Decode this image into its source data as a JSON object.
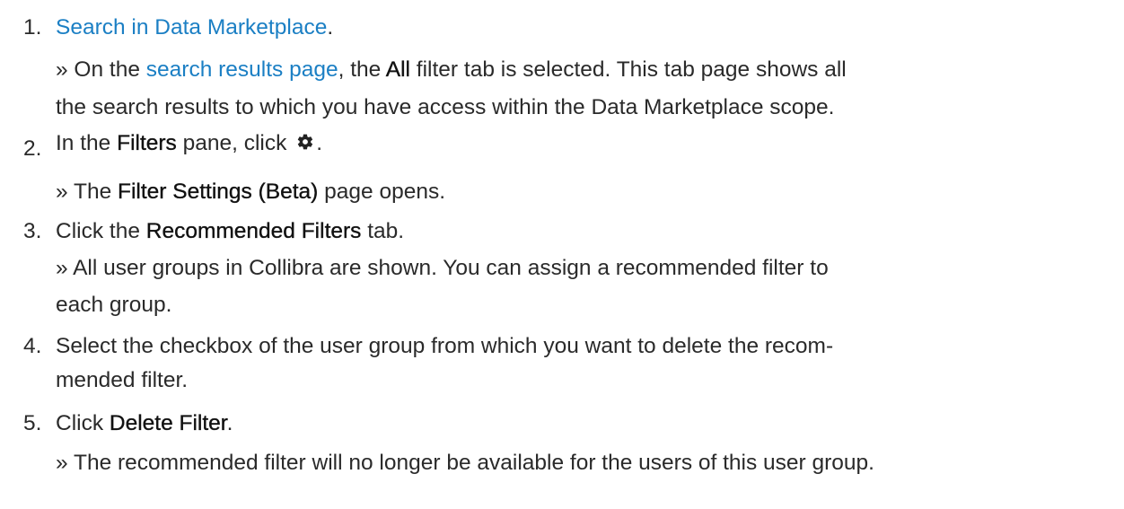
{
  "steps": [
    {
      "number": "1.",
      "link_text": "Search in Data Marketplace",
      "period": ".",
      "result": {
        "prefix": "» On the ",
        "link_text": "search results page",
        "mid1": ", the ",
        "bold": "All",
        "rest1": " filter tab is selected. This tab page shows all",
        "line2": "the search results to which you have access within the Data Marketplace scope."
      }
    },
    {
      "number": "2.",
      "pre": "In the ",
      "bold": "Filters",
      "mid": " pane, click ",
      "icon": "gear-icon",
      "period": ".",
      "result": {
        "prefix": "» The ",
        "bold": "Filter Settings (Beta)",
        "rest": " page opens."
      }
    },
    {
      "number": "3.",
      "pre": "Click the ",
      "bold": "Recommended Filters",
      "rest": " tab.",
      "result": {
        "line1": "» All user groups in Collibra are shown. You can assign a recommended filter to",
        "line2": "each group."
      }
    },
    {
      "number": "4.",
      "line1": "Select the checkbox of the user group from which you want to delete the recom-",
      "line2": "mended filter."
    },
    {
      "number": "5.",
      "pre": "Click ",
      "bold": "Delete Filter",
      "period": ".",
      "result": {
        "line1": "» The recommended filter will no longer be available for the users of this user group."
      }
    }
  ]
}
